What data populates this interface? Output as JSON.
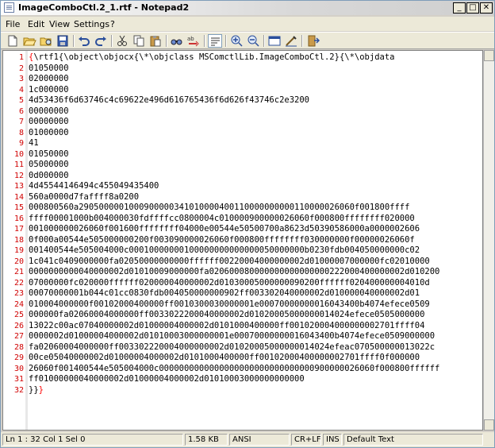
{
  "window": {
    "title": "ImageComboCtl.2_1.rtf - Notepad2",
    "minimize": "_",
    "maximize": "□",
    "close": "✕"
  },
  "menu": [
    "File",
    "Edit",
    "View",
    "Settings",
    "?"
  ],
  "toolbar": [
    "new-file-icon",
    "open-folder-icon",
    "browse-icon",
    "save-icon",
    "undo-icon",
    "redo-icon",
    "cut-icon",
    "copy-icon",
    "paste-icon",
    "find-icon",
    "replace-icon",
    "word-wrap-icon",
    "zoom-in-icon",
    "zoom-out-icon",
    "scheme-icon",
    "customize-icon",
    "exit-icon"
  ],
  "editor": {
    "lines": [
      "{\\rtf1{\\object\\objocx{\\*\\objclass MSComctlLib.ImageComboCtl.2}{\\*\\objdata",
      "01050000",
      "02000000",
      "1c000000",
      "4d53436f6d63746c4c69622e496d616765436f6d626f43746c2e3200",
      "00000000",
      "00000000",
      "01000000",
      "41",
      "01050000",
      "05000000",
      "0d000000",
      "4d45544146494c455049435400",
      "560a0000d7faffff8a0200",
      "000800560a2905000001000900000341010000400110000000000110000026060f001800ffff",
      "ffff00001000b004000030fdffffcc0800004c010000900000026060f000800ffffffff020000",
      "001000000026060f001600ffffffff04000e00544e50500700a8623d50390586000a0000002606",
      "0f000a00544e505000000200f003090000026060f000800ffffffff030000000f00000026060f",
      "001400544e505004000c00010000000100000000000000050000000b0230fdb004050000000c02",
      "1c041c0409000000fa02050000000000ffffff00220004000000002d01000007000000fc02010000",
      "0000000000040000002d01010009000000fa020600080000000000000000222000400000002d010200",
      "07000000fc020000ffffff020000040000002d01030005000000090200ffffff020400000004010d",
      "00070000001b044c01cc0830fdb004050000000902ff003302040000002d010000040000002d01",
      "010004000000f00102000400000ff0010300030000001e00070000000016043400b4074efece0509",
      "000000fa02060004000000ff0033022200040000002d01020005000000014024efece0505000000",
      "13022c00ac07040000002d01000004000002d0101000400000ff001020004000000002701ffff04",
      "0000002d01000004000002d01010003000000001e00070000000016043400b4074efece0509000000",
      "fa02060004000000ff003302220004000000002d01020005000000014024efeac070500000013022c",
      "00ce05040000002d01000004000002d0101000400000ff00102000400000002701ffff0f000000",
      "26060f001400544e505004000c0000000000000000000000000000000900000026060f000800ffffff",
      "ff01000000040000002d01000004000002d01010003000000000000",
      "}}}"
    ]
  },
  "status": {
    "position": "Ln 1 : 32   Col 1   Sel 0",
    "size": "1.58 KB",
    "encoding": "ANSI",
    "eol": "CR+LF",
    "ins": "INS",
    "scheme": "Default Text"
  }
}
